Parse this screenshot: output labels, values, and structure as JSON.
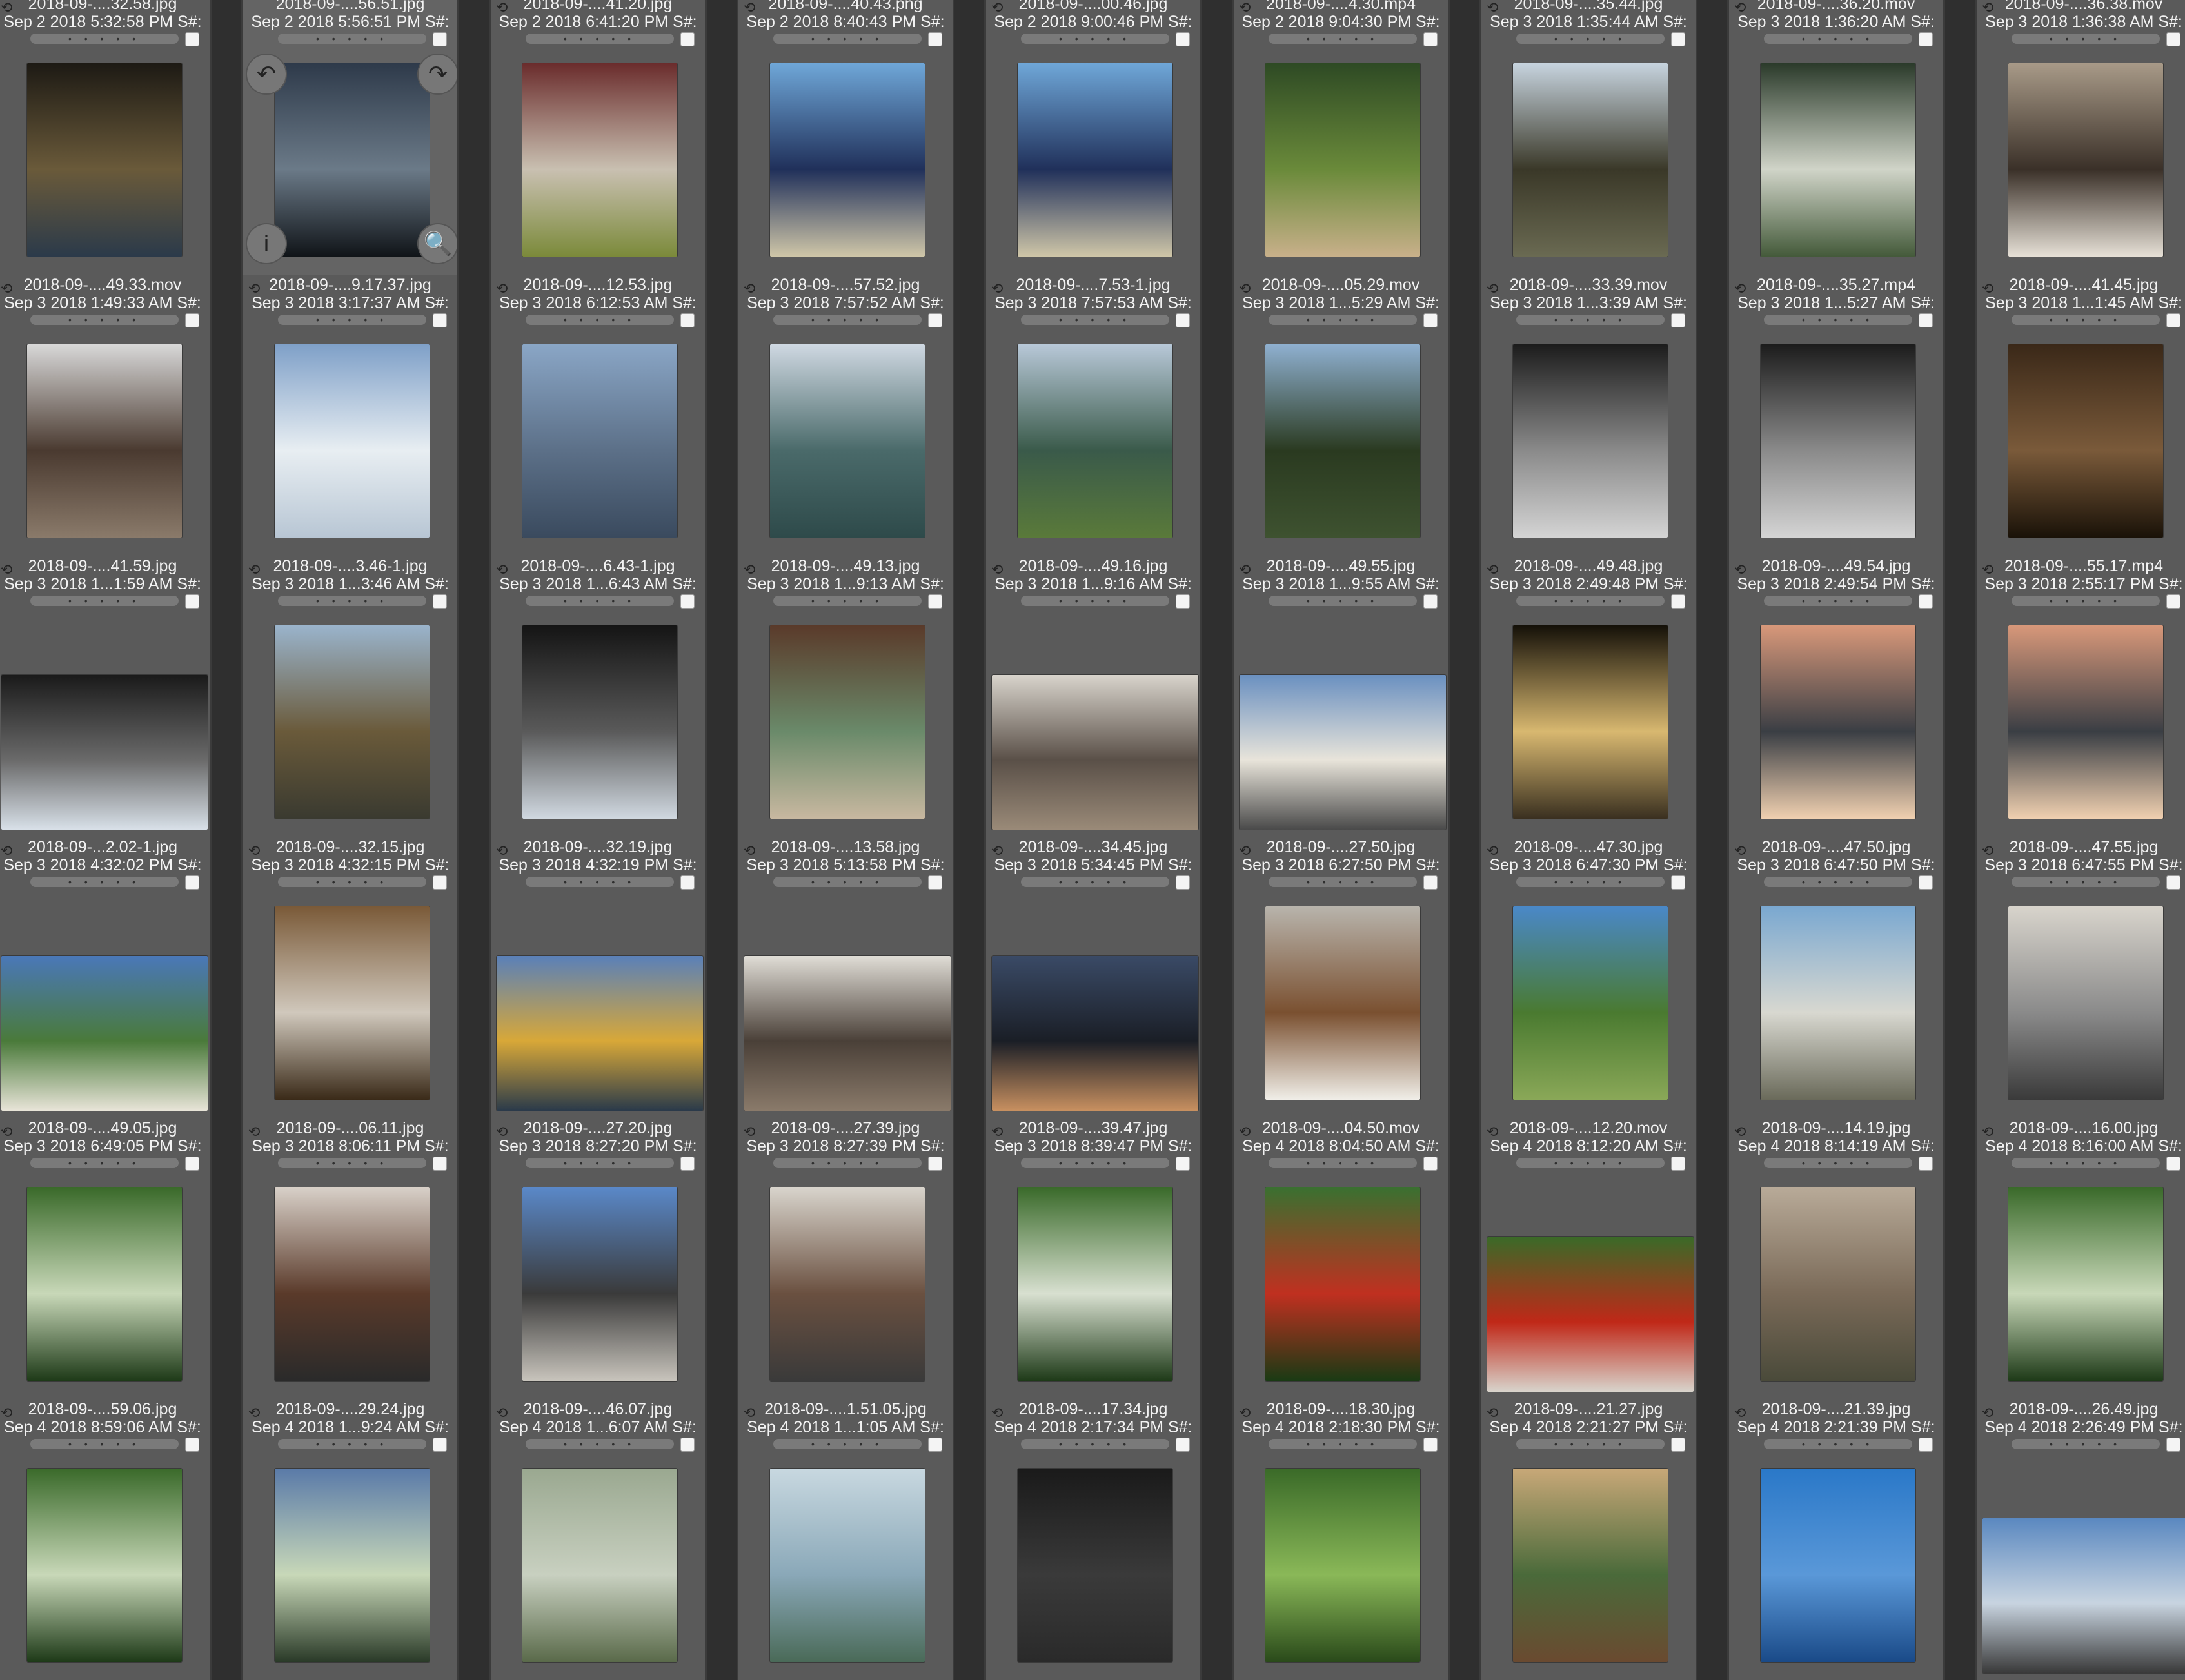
{
  "grid": {
    "rows": [
      [
        {
          "name": "2018-09-....49.33.mov",
          "date": "Sep 3 2018 1:49:33 AM S#:",
          "thumb": "landscape-night",
          "colors": [
            "#1d1a14",
            "#6a5a3a",
            "#2b3a4a"
          ],
          "orientation": "portrait"
        },
        {
          "name": "2018-09-....9.17.37.jpg",
          "date": "Sep 3 2018 3:17:37 AM S#:",
          "thumb": "sky-sea",
          "colors": [
            "#2e3a4a",
            "#6b7a88",
            "#101418"
          ],
          "orientation": "portrait",
          "selected": true
        },
        {
          "name": "2018-09-....12.53.jpg",
          "date": "Sep 3 2018 6:12:53 AM S#:",
          "thumb": "food",
          "colors": [
            "#6a2c2c",
            "#c9c0b1",
            "#7b8a3a"
          ],
          "orientation": "portrait"
        },
        {
          "name": "2018-09-....57.52.jpg",
          "date": "Sep 3 2018 7:57:52 AM S#:",
          "thumb": "airplane",
          "colors": [
            "#6fa7d8",
            "#20305a",
            "#cfc6a8"
          ],
          "orientation": "portrait"
        },
        {
          "name": "2018-09-....7.53-1.jpg",
          "date": "Sep 3 2018 7:57:53 AM S#:",
          "thumb": "airplane",
          "colors": [
            "#6fa7d8",
            "#20305a",
            "#cfc6a8"
          ],
          "orientation": "portrait"
        },
        {
          "name": "2018-09-....05.29.mov",
          "date": "Sep 3 2018 1...5:29 AM S#:",
          "thumb": "forest-window",
          "colors": [
            "#2e4a24",
            "#6a8a3a",
            "#c8b08a"
          ],
          "orientation": "portrait"
        },
        {
          "name": "2018-09-....33.39.mov",
          "date": "Sep 3 2018 1...3:39 AM S#:",
          "thumb": "train-window",
          "colors": [
            "#c7d4df",
            "#3a3828",
            "#6a6a52"
          ],
          "orientation": "portrait"
        },
        {
          "name": "2018-09-....35.27.mp4",
          "date": "Sep 3 2018 1...5:27 AM S#:",
          "thumb": "text-card",
          "colors": [
            "#2a3a2a",
            "#d0d4c8",
            "#445a3a"
          ],
          "orientation": "portrait"
        },
        {
          "name": "2018-09-....41.45.jpg",
          "date": "Sep 3 2018 1...1:45 AM S#:",
          "thumb": "selfie",
          "colors": [
            "#a89a88",
            "#3a3028",
            "#e6e0d6"
          ],
          "orientation": "portrait"
        }
      ],
      [
        {
          "name": "2018-09-....41.59.jpg",
          "date": "Sep 3 2018 1...1:59 AM S#:",
          "thumb": "selfie",
          "colors": [
            "#d8d8d8",
            "#4a3a30",
            "#8a7a6a"
          ],
          "orientation": "portrait"
        },
        {
          "name": "2018-09-....3.46-1.jpg",
          "date": "Sep 3 2018 1...3:46 AM S#:",
          "thumb": "clouds",
          "colors": [
            "#7fa0c8",
            "#e8eef2",
            "#b8c6d4"
          ],
          "orientation": "portrait"
        },
        {
          "name": "2018-09-....6.43-1.jpg",
          "date": "Sep 3 2018 1...6:43 AM S#:",
          "thumb": "sea",
          "colors": [
            "#8aa6c6",
            "#5c7088",
            "#3a4a5e"
          ],
          "orientation": "portrait"
        },
        {
          "name": "2018-09-....49.13.jpg",
          "date": "Sep 3 2018 1...9:13 AM S#:",
          "thumb": "wing-sea",
          "colors": [
            "#cfd8e2",
            "#4a6a6a",
            "#2e4a4a"
          ],
          "orientation": "portrait"
        },
        {
          "name": "2018-09-....49.16.jpg",
          "date": "Sep 3 2018 1...9:16 AM S#:",
          "thumb": "wing-coast",
          "colors": [
            "#b8c8d8",
            "#3a5a4a",
            "#5a7a3a"
          ],
          "orientation": "portrait"
        },
        {
          "name": "2018-09-....49.55.jpg",
          "date": "Sep 3 2018 1...9:55 AM S#:",
          "thumb": "forest-aerial",
          "colors": [
            "#8fb0d0",
            "#2a3a20",
            "#3e5230"
          ],
          "orientation": "portrait"
        },
        {
          "name": "2018-09-....49.48.jpg",
          "date": "Sep 3 2018 2:49:48 PM S#:",
          "thumb": "station",
          "colors": [
            "#1c1c1c",
            "#8a8a8a",
            "#d4d4d4"
          ],
          "orientation": "portrait"
        },
        {
          "name": "2018-09-....49.54.jpg",
          "date": "Sep 3 2018 2:49:54 PM S#:",
          "thumb": "station",
          "colors": [
            "#1c1c1c",
            "#8a8a8a",
            "#d4d4d4"
          ],
          "orientation": "portrait"
        },
        {
          "name": "2018-09-....55.17.mp4",
          "date": "Sep 3 2018 2:55:17 PM S#:",
          "thumb": "basket-cat",
          "colors": [
            "#3a2818",
            "#7a5a3a",
            "#1a1208"
          ],
          "orientation": "portrait"
        }
      ],
      [
        {
          "name": "2018-09-...2.02-1.jpg",
          "date": "Sep 3 2018 4:32:02 PM S#:",
          "thumb": "train-interior",
          "colors": [
            "#1a1a1a",
            "#6a6a6a",
            "#d8e0e8"
          ],
          "orientation": "landscape"
        },
        {
          "name": "2018-09-....32.15.jpg",
          "date": "Sep 3 2018 4:32:15 PM S#:",
          "thumb": "platform",
          "colors": [
            "#9ab4cc",
            "#6a5a3a",
            "#3a3a30"
          ],
          "orientation": "portrait"
        },
        {
          "name": "2018-09-....32.19.jpg",
          "date": "Sep 3 2018 4:32:19 PM S#:",
          "thumb": "train-interior",
          "colors": [
            "#141414",
            "#5a5a5a",
            "#d0d8e0"
          ],
          "orientation": "portrait"
        },
        {
          "name": "2018-09-....13.58.jpg",
          "date": "Sep 3 2018 5:13:58 PM S#:",
          "thumb": "shop",
          "colors": [
            "#5a3a2a",
            "#6a8a6a",
            "#c8b8a0"
          ],
          "orientation": "portrait"
        },
        {
          "name": "2018-09-....34.45.jpg",
          "date": "Sep 3 2018 5:34:45 PM S#:",
          "thumb": "room",
          "colors": [
            "#d8d4cc",
            "#5a5048",
            "#9a8a78"
          ],
          "orientation": "landscape"
        },
        {
          "name": "2018-09-....27.50.jpg",
          "date": "Sep 3 2018 6:27:50 PM S#:",
          "thumb": "farmhouse",
          "colors": [
            "#6a90c0",
            "#e8e4da",
            "#4a4a4a"
          ],
          "orientation": "landscape"
        },
        {
          "name": "2018-09-....47.30.jpg",
          "date": "Sep 3 2018 6:47:30 PM S#:",
          "thumb": "tunnel-sun",
          "colors": [
            "#141008",
            "#d8b870",
            "#3a3020"
          ],
          "orientation": "portrait"
        },
        {
          "name": "2018-09-....47.50.jpg",
          "date": "Sep 3 2018 6:47:50 PM S#:",
          "thumb": "eggs",
          "colors": [
            "#d8987a",
            "#3a3e44",
            "#f0d0b0"
          ],
          "orientation": "portrait"
        },
        {
          "name": "2018-09-....47.55.jpg",
          "date": "Sep 3 2018 6:47:55 PM S#:",
          "thumb": "eggs",
          "colors": [
            "#d8987a",
            "#3a3e44",
            "#f0d0b0"
          ],
          "orientation": "portrait"
        }
      ],
      [
        {
          "name": "2018-09-....49.05.jpg",
          "date": "Sep 3 2018 6:49:05 PM S#:",
          "thumb": "field-house",
          "colors": [
            "#4a78b8",
            "#4a7a3a",
            "#e8e4d8"
          ],
          "orientation": "landscape"
        },
        {
          "name": "2018-09-....06.11.jpg",
          "date": "Sep 3 2018 8:06:11 PM S#:",
          "thumb": "basket-kittens",
          "colors": [
            "#7a5a38",
            "#d0c8bc",
            "#3a2a18"
          ],
          "orientation": "portrait"
        },
        {
          "name": "2018-09-....27.20.jpg",
          "date": "Sep 3 2018 8:27:20 PM S#:",
          "thumb": "window-yellow",
          "colors": [
            "#5a80b8",
            "#d8a838",
            "#2a3a4a"
          ],
          "orientation": "landscape"
        },
        {
          "name": "2018-09-....27.39.jpg",
          "date": "Sep 3 2018 8:27:39 PM S#:",
          "thumb": "kitchen",
          "colors": [
            "#e0ddd6",
            "#4a4038",
            "#8a7a6a"
          ],
          "orientation": "landscape"
        },
        {
          "name": "2018-09-....39.47.jpg",
          "date": "Sep 3 2018 8:39:47 PM S#:",
          "thumb": "dusk",
          "colors": [
            "#3a4a66",
            "#1a1e26",
            "#c89060"
          ],
          "orientation": "landscape"
        },
        {
          "name": "2018-09-....04.50.mov",
          "date": "Sep 4 2018 8:04:50 AM S#:",
          "thumb": "dog",
          "colors": [
            "#b8b4ac",
            "#7a5030",
            "#f0eee8"
          ],
          "orientation": "portrait"
        },
        {
          "name": "2018-09-....12.20.mov",
          "date": "Sep 4 2018 8:12:20 AM S#:",
          "thumb": "meadow",
          "colors": [
            "#4a88c8",
            "#4a7a30",
            "#8aa858"
          ],
          "orientation": "portrait"
        },
        {
          "name": "2018-09-....14.19.jpg",
          "date": "Sep 4 2018 8:14:19 AM S#:",
          "thumb": "barn",
          "colors": [
            "#7aa8d0",
            "#d8d8d0",
            "#6a6a5a"
          ],
          "orientation": "portrait"
        },
        {
          "name": "2018-09-....16.00.jpg",
          "date": "Sep 4 2018 8:16:00 AM S#:",
          "thumb": "machine",
          "colors": [
            "#d8d4cc",
            "#8a8a8a",
            "#3a3a3a"
          ],
          "orientation": "portrait"
        }
      ],
      [
        {
          "name": "2018-09-....59.06.jpg",
          "date": "Sep 4 2018 8:59:06 AM S#:",
          "thumb": "greenhouse",
          "colors": [
            "#3a6a2a",
            "#c8d8b8",
            "#1e3a18"
          ],
          "orientation": "portrait"
        },
        {
          "name": "2018-09-....29.24.jpg",
          "date": "Sep 4 2018 1...9:24 AM S#:",
          "thumb": "selfie-laptop",
          "colors": [
            "#d8d0c8",
            "#5a3a2a",
            "#2a2a2a"
          ],
          "orientation": "portrait"
        },
        {
          "name": "2018-09-....46.07.jpg",
          "date": "Sep 4 2018 1...6:07 AM S#:",
          "thumb": "skylight",
          "colors": [
            "#5a88c8",
            "#3a3a3a",
            "#c8c4bc"
          ],
          "orientation": "portrait"
        },
        {
          "name": "2018-09-....1.51.05.jpg",
          "date": "Sep 4 2018 1...1:05 AM S#:",
          "thumb": "desk",
          "colors": [
            "#d8d4cc",
            "#6a5040",
            "#3a3a3a"
          ],
          "orientation": "portrait"
        },
        {
          "name": "2018-09-....17.34.jpg",
          "date": "Sep 4 2018 2:17:34 PM S#:",
          "thumb": "plants",
          "colors": [
            "#3a6a2a",
            "#d8e0d0",
            "#1e3a18"
          ],
          "orientation": "portrait"
        },
        {
          "name": "2018-09-....18.30.jpg",
          "date": "Sep 4 2018 2:18:30 PM S#:",
          "thumb": "tomatoes",
          "colors": [
            "#3a7030",
            "#c03020",
            "#1a3a14"
          ],
          "orientation": "portrait"
        },
        {
          "name": "2018-09-....21.27.jpg",
          "date": "Sep 4 2018 2:21:27 PM S#:",
          "thumb": "cucumbers",
          "colors": [
            "#3a6a28",
            "#c02818",
            "#d8d4cc"
          ],
          "orientation": "landscape"
        },
        {
          "name": "2018-09-....21.39.jpg",
          "date": "Sep 4 2018 2:21:39 PM S#:",
          "thumb": "wooden-door",
          "colors": [
            "#b8aa98",
            "#7a6a58",
            "#4a4a3a"
          ],
          "orientation": "portrait"
        },
        {
          "name": "2018-09-....26.49.jpg",
          "date": "Sep 4 2018 2:26:49 PM S#:",
          "thumb": "greenhouse",
          "colors": [
            "#3a6a2a",
            "#c8d8b8",
            "#1e3a18"
          ],
          "orientation": "portrait"
        }
      ],
      [
        {
          "name": "",
          "date": "",
          "thumb": "greenhouse",
          "colors": [
            "#3a6a2a",
            "#c8d8b8",
            "#1e3a18"
          ],
          "orientation": "portrait"
        },
        {
          "name": "",
          "date": "",
          "thumb": "greenhouse",
          "colors": [
            "#5a7aa8",
            "#c8d8b8",
            "#2a3a28"
          ],
          "orientation": "portrait"
        },
        {
          "name": "",
          "date": "",
          "thumb": "greenhouse",
          "colors": [
            "#9aa890",
            "#c8d0c0",
            "#5a6a4a"
          ],
          "orientation": "portrait"
        },
        {
          "name": "",
          "date": "",
          "thumb": "greenhouse",
          "colors": [
            "#c8d8e0",
            "#8aa8b8",
            "#4a6a58"
          ],
          "orientation": "portrait"
        },
        {
          "name": "",
          "date": "",
          "thumb": "dark",
          "colors": [
            "#1a1a1a",
            "#3a3a3a",
            "#2a2a2a"
          ],
          "orientation": "portrait"
        },
        {
          "name": "",
          "date": "",
          "thumb": "trees",
          "colors": [
            "#3a6a28",
            "#8ab858",
            "#2a4a1a"
          ],
          "orientation": "portrait"
        },
        {
          "name": "",
          "date": "",
          "thumb": "house",
          "colors": [
            "#c8a878",
            "#4a6a3a",
            "#6a4a30"
          ],
          "orientation": "portrait"
        },
        {
          "name": "",
          "date": "",
          "thumb": "sky",
          "colors": [
            "#2a78c8",
            "#5a98d8",
            "#1a4a88"
          ],
          "orientation": "portrait"
        },
        {
          "name": "",
          "date": "",
          "thumb": "sky",
          "colors": [
            "#5a88c0",
            "#c8d4e0",
            "#3a3a3a"
          ],
          "orientation": "landscape"
        }
      ]
    ],
    "top_band": [
      {
        "name": "2018-09-....32.58.jpg",
        "date": "Sep 2 2018 5:32:58 PM S#:"
      },
      {
        "name": "2018-09-....56.51.jpg",
        "date": "Sep 2 2018 5:56:51 PM S#:"
      },
      {
        "name": "2018-09-....41.20.jpg",
        "date": "Sep 2 2018 6:41:20 PM S#:"
      },
      {
        "name": "2018-09-....40.43.png",
        "date": "Sep 2 2018 8:40:43 PM S#:"
      },
      {
        "name": "2018-09-....00.46.jpg",
        "date": "Sep 2 2018 9:00:46 PM S#:"
      },
      {
        "name": "2018-09-....4.30.mp4",
        "date": "Sep 2 2018 9:04:30 PM S#:"
      },
      {
        "name": "2018-09-....35.44.jpg",
        "date": "Sep 3 2018 1:35:44 AM S#:"
      },
      {
        "name": "2018-09-....36.20.mov",
        "date": "Sep 3 2018 1:36:20 AM S#:"
      },
      {
        "name": "2018-09-....36.38.mov",
        "date": "Sep 3 2018 1:36:38 AM S#:"
      }
    ],
    "rating_dots": "• • • • •",
    "overlay_buttons": {
      "rotate_left": "↶",
      "rotate_right": "↷",
      "info": "i",
      "zoom": "🔍"
    },
    "rotate_glyph": "⟲"
  }
}
